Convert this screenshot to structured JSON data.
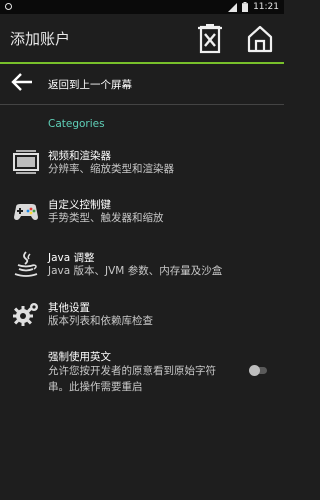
{
  "status_bar": {
    "time": "11:21"
  },
  "appbar": {
    "title": "添加账户",
    "accent_color": "#78c02b"
  },
  "back": {
    "label": "返回到上一个屏幕"
  },
  "category": {
    "title": "Categories",
    "color": "#5fd0b8"
  },
  "items": [
    {
      "title": "视频和渲染器",
      "subtitle": "分辨率、缩放类型和渲染器",
      "icon": "display-icon"
    },
    {
      "title": "自定义控制键",
      "subtitle": "手势类型、触发器和缩放",
      "icon": "gamepad-icon"
    },
    {
      "title": "Java 调整",
      "subtitle": "Java 版本、JVM 参数、内存量及沙盒",
      "icon": "java-icon"
    },
    {
      "title": "其他设置",
      "subtitle": "版本列表和依赖库检查",
      "icon": "gears-icon"
    },
    {
      "title": "强制使用英文",
      "subtitle_line1": "允许您按开发者的原意看到原始字符",
      "subtitle_line2": "串。此操作需要重启",
      "toggle_on": false
    }
  ]
}
